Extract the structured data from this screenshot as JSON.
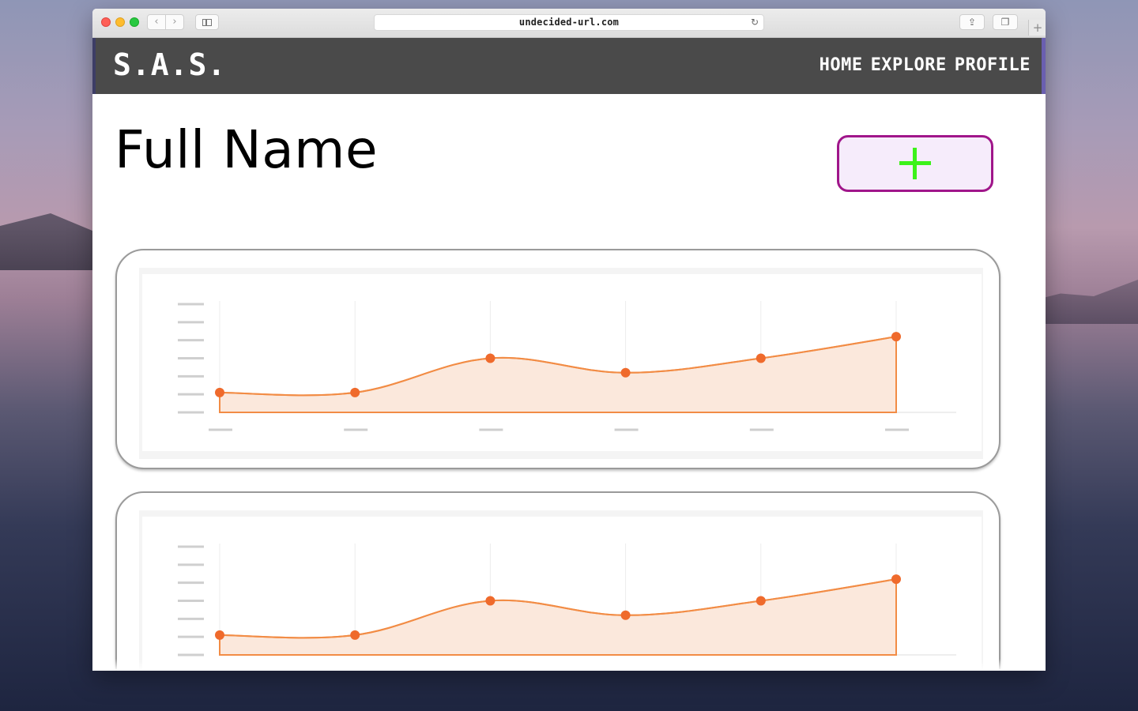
{
  "browser": {
    "url": "undecided-url.com"
  },
  "site": {
    "logo": "S.A.S.",
    "nav": [
      "HOME",
      "EXPLORE",
      "PROFILE"
    ]
  },
  "profile": {
    "name": "Full Name"
  },
  "colors": {
    "header_bg": "#4a4a4a",
    "add_button_border": "#a0168a",
    "add_button_bg": "#f6ecfb",
    "plus_color": "#3cf21a",
    "chart_line": "#f28c45",
    "chart_fill": "#fbe8dc",
    "chart_point": "#ef6a2c"
  },
  "icons": {
    "add_button": "plus-icon"
  },
  "chart_data": [
    {
      "type": "area",
      "x": [
        1,
        2,
        3,
        4,
        5,
        6
      ],
      "series": [
        {
          "values": [
            1.1,
            1.1,
            3.0,
            2.2,
            3.0,
            4.2
          ]
        }
      ],
      "ylim": [
        0,
        6
      ],
      "y_ticks": 7,
      "grid": "vertical"
    },
    {
      "type": "area",
      "x": [
        1,
        2,
        3,
        4,
        5,
        6
      ],
      "series": [
        {
          "values": [
            1.1,
            1.1,
            3.0,
            2.2,
            3.0,
            4.2
          ]
        }
      ],
      "ylim": [
        0,
        6
      ],
      "y_ticks": 7,
      "grid": "vertical"
    }
  ]
}
